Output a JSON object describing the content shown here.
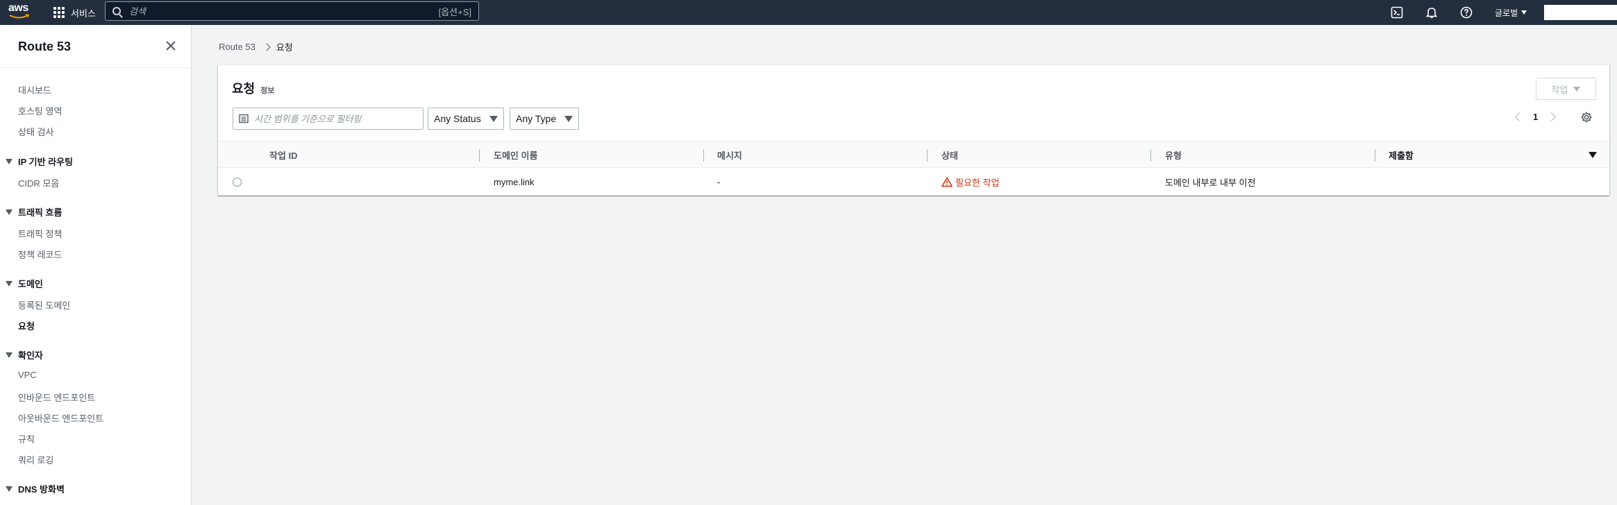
{
  "topnav": {
    "logo": "aws",
    "services_label": "서비스",
    "search_placeholder": "검색",
    "search_shortcut": "[옵션+S]",
    "region_label": "글로벌"
  },
  "sidebar": {
    "title": "Route 53",
    "items": [
      {
        "label": "대시보드"
      },
      {
        "label": "호스팅 영역"
      },
      {
        "label": "상태 검사"
      }
    ],
    "sections": [
      {
        "label": "IP 기반 라우팅",
        "items": [
          {
            "label": "CIDR 모음"
          }
        ]
      },
      {
        "label": "트래픽 흐름",
        "items": [
          {
            "label": "트래픽 정책"
          },
          {
            "label": "정책 레코드"
          }
        ]
      },
      {
        "label": "도메인",
        "items": [
          {
            "label": "등록된 도메인"
          },
          {
            "label": "요청",
            "active": true
          }
        ]
      },
      {
        "label": "확인자",
        "items": [
          {
            "label": "VPC"
          },
          {
            "label": "인바운드 엔드포인트"
          },
          {
            "label": "아웃바운드 엔드포인트"
          },
          {
            "label": "규칙"
          },
          {
            "label": "쿼리 로깅"
          }
        ]
      },
      {
        "label": "DNS 방화벽",
        "items": []
      }
    ]
  },
  "breadcrumb": {
    "parent": "Route 53",
    "current": "요청"
  },
  "panel": {
    "title": "요청",
    "info": "정보",
    "actions_label": "작업",
    "filter_placeholder": "시간 범위를 기준으로 필터링",
    "status_select": "Any Status",
    "type_select": "Any Type",
    "page": "1"
  },
  "table": {
    "columns": [
      "작업 ID",
      "도메인 이름",
      "메시지",
      "상태",
      "유형",
      "제출함"
    ],
    "rows": [
      {
        "op_id": "",
        "domain": "myme.link",
        "message": "-",
        "status": "필요한 작업",
        "type": "도메인 내부로 내부 이전",
        "submitted": ""
      }
    ]
  },
  "colors": {
    "nav_bg": "#232f3e",
    "warning": "#d13212"
  }
}
